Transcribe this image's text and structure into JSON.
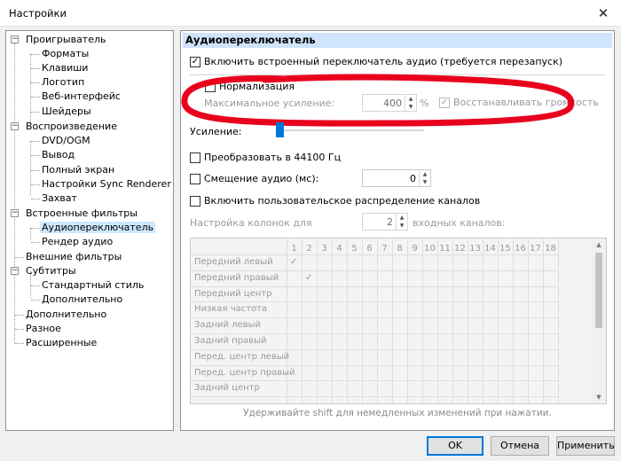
{
  "window": {
    "title": "Настройки",
    "close_glyph": "✕"
  },
  "tree": {
    "items": [
      {
        "label": "Проигрыватель",
        "expander": "−"
      },
      {
        "label": "Форматы"
      },
      {
        "label": "Клавиши"
      },
      {
        "label": "Логотип"
      },
      {
        "label": "Веб-интерфейс"
      },
      {
        "label": "Шейдеры"
      },
      {
        "label": "Воспроизведение",
        "expander": "−"
      },
      {
        "label": "DVD/OGM"
      },
      {
        "label": "Вывод"
      },
      {
        "label": "Полный экран"
      },
      {
        "label": "Настройки Sync Renderer"
      },
      {
        "label": "Захват"
      },
      {
        "label": "Встроенные фильтры",
        "expander": "−"
      },
      {
        "label": "Аудиопереключатель",
        "selected": true
      },
      {
        "label": "Рендер аудио"
      },
      {
        "label": "Внешние фильтры"
      },
      {
        "label": "Субтитры",
        "expander": "−"
      },
      {
        "label": "Стандартный стиль"
      },
      {
        "label": "Дополнительно"
      },
      {
        "label": "Дополнительно"
      },
      {
        "label": "Разное"
      },
      {
        "label": "Расширенные"
      }
    ]
  },
  "panel": {
    "header": "Аудиопереключатель",
    "enable_switcher": {
      "label": "Включить встроенный переключатель аудио (требуется перезапуск)",
      "checked": true
    },
    "normalization": {
      "label": "Нормализация",
      "checked": false
    },
    "max_gain": {
      "label": "Максимальное усиление:",
      "value": "400",
      "unit": "%"
    },
    "restore_volume": {
      "label": "Восстанавливать громкость",
      "checked": true
    },
    "gain": {
      "label": "Усиление:",
      "level": 0.0
    },
    "resample": {
      "label": "Преобразовать в 44100 Гц",
      "checked": false
    },
    "audio_offset": {
      "label": "Смещение аудио (мс):",
      "value": "0",
      "checked": false
    },
    "custom_mapping": {
      "label": "Включить пользовательское распределение каналов",
      "checked": false
    },
    "speaker_config": {
      "label": "Настройка колонок для",
      "value": "2",
      "suffix": "входных каналов:"
    },
    "matrix": {
      "columns": [
        "1",
        "2",
        "3",
        "4",
        "5",
        "6",
        "7",
        "8",
        "9",
        "10",
        "11",
        "12",
        "13",
        "14",
        "15",
        "16",
        "17",
        "18"
      ],
      "rows": [
        "Передний левый",
        "Передний правый",
        "Передний центр",
        "Низкая частота",
        "Задний левый",
        "Задний правый",
        "Перед. центр левый",
        "Перед. центр правый",
        "Задний центр"
      ],
      "check_glyph": "✓"
    },
    "hint": "Удерживайте shift для немедленных изменений при нажатии."
  },
  "buttons": {
    "ok": "OK",
    "cancel": "Отмена",
    "apply": "Применить"
  },
  "annotation_color": "#e8001c",
  "accent_color": "#0078d7"
}
